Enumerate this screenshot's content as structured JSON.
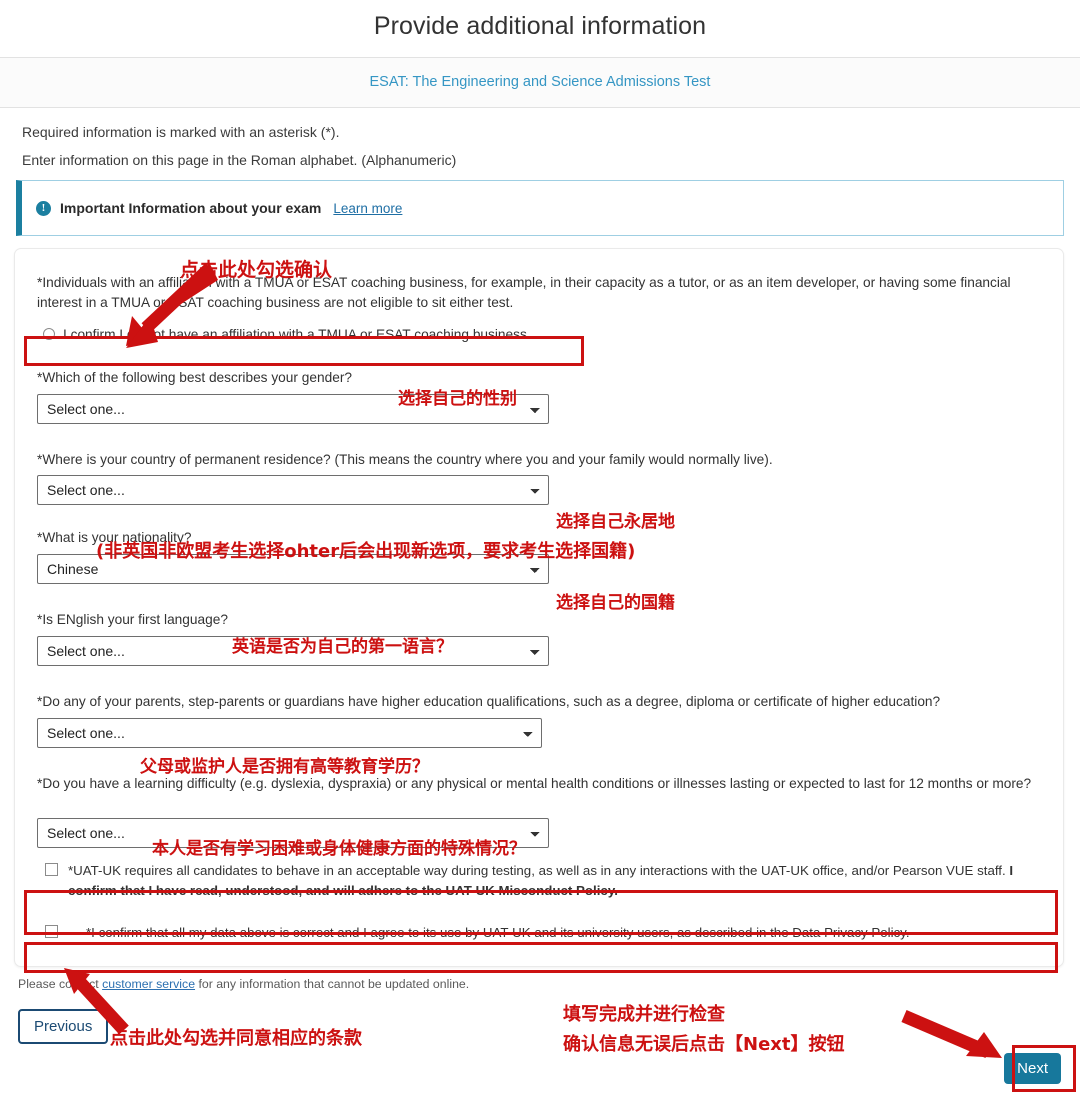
{
  "header": {
    "title": "Provide additional information",
    "subtitle": "ESAT: The Engineering and Science Admissions Test"
  },
  "intro": {
    "line1": "Required information is marked with an asterisk (*).",
    "line2": "Enter information on this page in the Roman alphabet. (Alphanumeric)"
  },
  "info_banner": {
    "icon": "info-circle-icon",
    "text": "Important Information about your exam",
    "link": "Learn more"
  },
  "form": {
    "affiliation_statement": "*Individuals with an affiliation with a TMUA or ESAT coaching business, for example, in their capacity as a tutor, or as an item developer, or having some financial interest in a TMUA or ESAT coaching business are not eligible to sit either test.",
    "affiliation_radio_label": "I confirm I do not have an affiliation with a TMUA or ESAT coaching business",
    "gender_question": "*Which of the following best describes your gender?",
    "gender_value": "Select one...",
    "residence_question": "*Where is your country of permanent residence? (This means the country where you and your family would normally live).",
    "residence_value": "Select one...",
    "nationality_question": "*What is your nationality?",
    "nationality_value": "Chinese",
    "language_question": "*Is ENglish your first language?",
    "language_value": "Select one...",
    "parents_question": "*Do any of your parents, step-parents or guardians have higher education qualifications, such as a degree, diploma or certificate of higher education?",
    "parents_value": "Select one...",
    "disability_question": "*Do you have a learning difficulty (e.g. dyslexia, dyspraxia) or any physical or mental health conditions or illnesses lasting or expected to last for 12 months or more?",
    "disability_value": "Select one...",
    "misconduct_text_normal": "*UAT-UK requires all candidates to behave in an acceptable way during testing, as well as in any interactions with the UAT-UK office, and/or Pearson VUE staff. ",
    "misconduct_text_bold": "I confirm that I have read, understood, and will adhere to the UAT-UK Misconduct Policy.",
    "privacy_text": "*I confirm that all my data above is correct and I agree to its use by UAT-UK and its university users, as described in the Data Privacy Policy."
  },
  "footer": {
    "text_before": "Please contact ",
    "link": "customer service",
    "text_after": " for any information that cannot be updated online.",
    "previous_label": "Previous",
    "next_label": "Next"
  },
  "annotations": {
    "confirm_click": "点击此处勾选确认",
    "gender": "选择自己的性别",
    "residence": "选择自己永居地",
    "residence_note": "(非英国非欧盟考生选择ohter后会出现新选项，要求考生选择国籍)",
    "nationality": "选择自己的国籍",
    "language": "英语是否为自己的第一语言？",
    "parents": "父母或监护人是否拥有高等教育学历？",
    "disability": "本人是否有学习困难或身体健康方面的特殊情况？",
    "agree_terms": "点击此处勾选并同意相应的条款",
    "check_line1": "填写完成并进行检查",
    "check_line2": "确认信息无误后点击【Next】按钮"
  },
  "colors": {
    "annotation_red": "#cc1111",
    "subtitle_blue": "#3596c4",
    "next_button": "#17789c",
    "previous_border": "#1b4a73",
    "info_accent": "#1b7fa0"
  }
}
